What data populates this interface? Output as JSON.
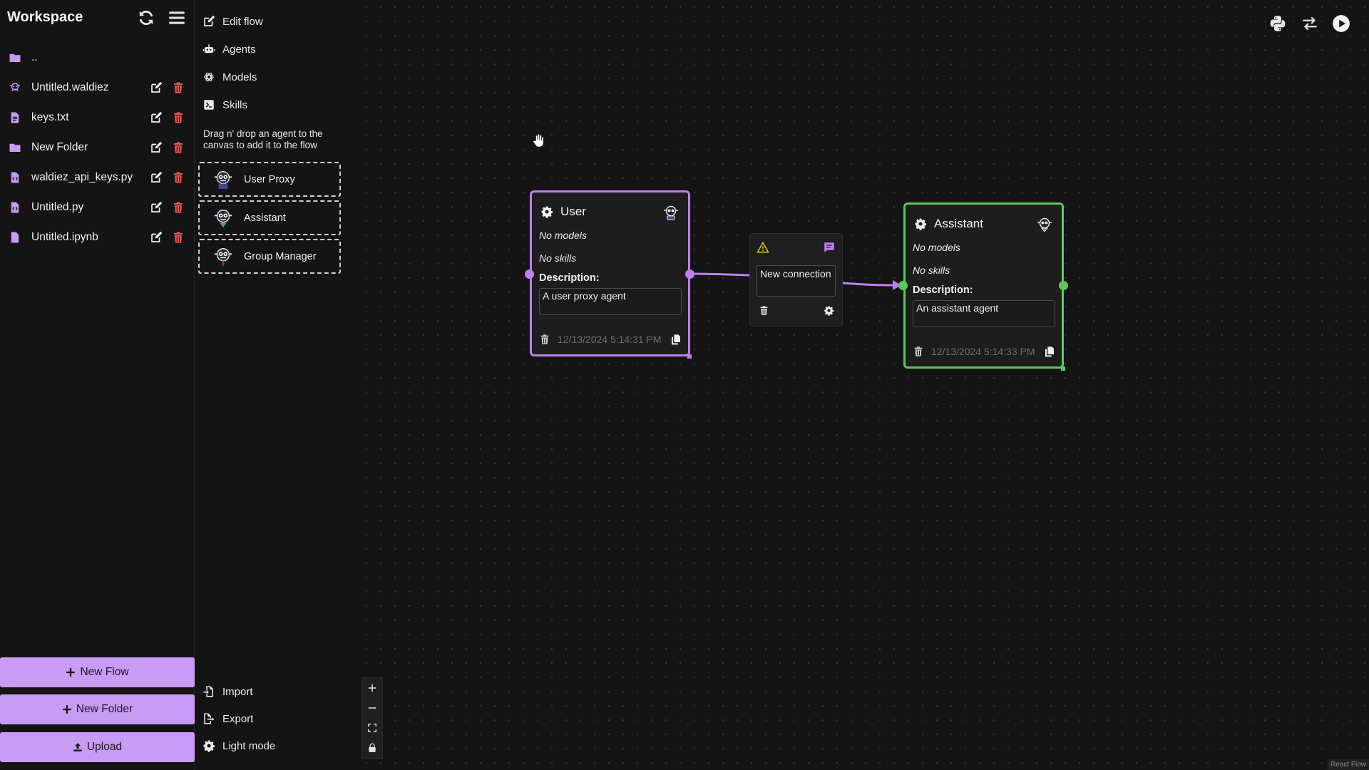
{
  "workspace": {
    "title": "Workspace",
    "items": [
      {
        "name": "..",
        "icon": "folder-icon"
      },
      {
        "name": "Untitled.waldiez",
        "icon": "waldiez-icon"
      },
      {
        "name": "keys.txt",
        "icon": "file-text-icon"
      },
      {
        "name": "New Folder",
        "icon": "folder-icon"
      },
      {
        "name": "waldiez_api_keys.py",
        "icon": "file-code-icon"
      },
      {
        "name": "Untitled.py",
        "icon": "file-code-icon"
      },
      {
        "name": "Untitled.ipynb",
        "icon": "file-icon"
      }
    ],
    "buttons": {
      "new_flow": "New Flow",
      "new_folder": "New Folder",
      "upload": "Upload"
    }
  },
  "panel": {
    "menu": {
      "edit_flow": "Edit flow",
      "agents": "Agents",
      "models": "Models",
      "skills": "Skills"
    },
    "hint": "Drag n' drop an agent to the canvas to add it to the flow",
    "agents": [
      "User Proxy",
      "Assistant",
      "Group Manager"
    ],
    "bottom": {
      "import": "Import",
      "export": "Export",
      "light_mode": "Light mode"
    }
  },
  "canvas": {
    "user_node": {
      "name": "User",
      "models": "No models",
      "skills": "No skills",
      "description_label": "Description:",
      "description": "A user proxy agent",
      "timestamp": "12/13/2024 5:14:31 PM",
      "color": "#c17ef0"
    },
    "assistant_node": {
      "name": "Assistant",
      "models": "No models",
      "skills": "No skills",
      "description_label": "Description:",
      "description": "An assistant agent",
      "timestamp": "12/13/2024 5:14:33 PM",
      "color": "#5cc85a"
    },
    "edge": {
      "label": "New connection",
      "warning_color": "#e6c229",
      "message_color": "#c17ef0"
    },
    "attribution": "React Flow"
  },
  "colors": {
    "accent": "#c89bf5",
    "danger": "#e85a5a",
    "background": "#141414"
  }
}
